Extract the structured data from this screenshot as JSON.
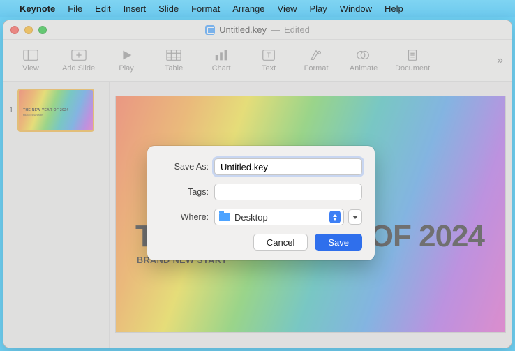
{
  "menubar": {
    "apple": "",
    "app": "Keynote",
    "items": [
      "File",
      "Edit",
      "Insert",
      "Slide",
      "Format",
      "Arrange",
      "View",
      "Play",
      "Window",
      "Help"
    ]
  },
  "window": {
    "doc_name": "Untitled.key",
    "status": "Edited"
  },
  "toolbar": {
    "items": [
      {
        "label": "View",
        "icon": "view"
      },
      {
        "label": "Add Slide",
        "icon": "add-slide"
      },
      {
        "label": "Play",
        "icon": "play"
      },
      {
        "label": "Table",
        "icon": "table"
      },
      {
        "label": "Chart",
        "icon": "chart"
      },
      {
        "label": "Text",
        "icon": "text"
      },
      {
        "label": "Format",
        "icon": "format"
      },
      {
        "label": "Animate",
        "icon": "animate"
      },
      {
        "label": "Document",
        "icon": "document"
      }
    ],
    "more": "»"
  },
  "navigator": {
    "slide_number": "1",
    "thumb_title": "THE NEW YEAR OF 2024",
    "thumb_sub": "BRAND NEW START"
  },
  "slide": {
    "title": "THE NEW YEAR OF 2024",
    "subtitle": "BRAND NEW START"
  },
  "dialog": {
    "saveas_label": "Save As:",
    "saveas_value": "Untitled.key",
    "tags_label": "Tags:",
    "tags_value": "",
    "where_label": "Where:",
    "where_value": "Desktop",
    "cancel": "Cancel",
    "save": "Save"
  }
}
